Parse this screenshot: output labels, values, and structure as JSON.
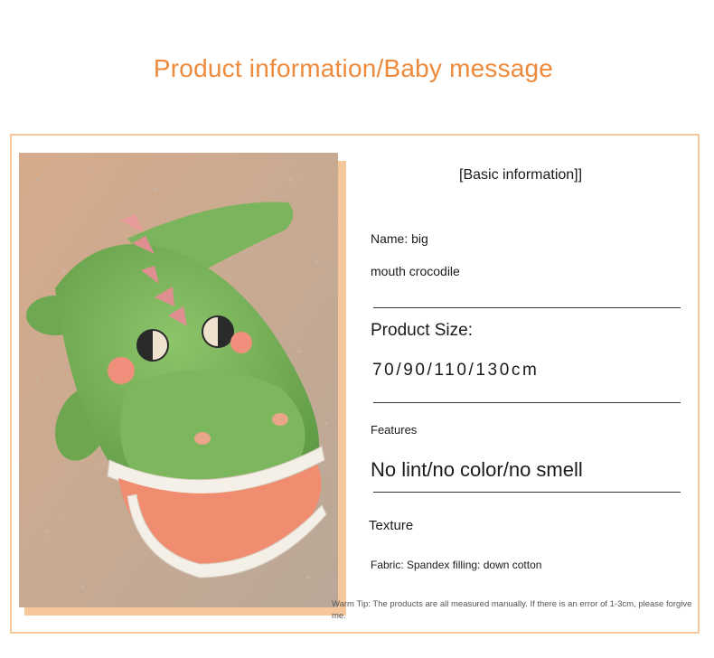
{
  "header": {
    "title": "Product information/Baby message"
  },
  "product_image": {
    "subject": "green plush big mouth crocodile toy"
  },
  "info": {
    "section_title": "[Basic information]]",
    "name_line1": "Name: big",
    "name_line2": "mouth crocodile",
    "size_label": "Product Size:",
    "size_value": "70/90/110/130cm",
    "features_label": "Features",
    "features_value": "No lint/no color/no smell",
    "texture_label": "Texture",
    "fabric": "Fabric: Spandex filling: down cotton",
    "warm_tip": "Warm Tip: The products are all measured manually. If there is an error of 1-3cm, please forgive me."
  },
  "colors": {
    "title_orange": "#ee8a3c",
    "border": "#f4c89a",
    "toy_green": "#78b35a",
    "mouth_salmon": "#f28e73"
  }
}
